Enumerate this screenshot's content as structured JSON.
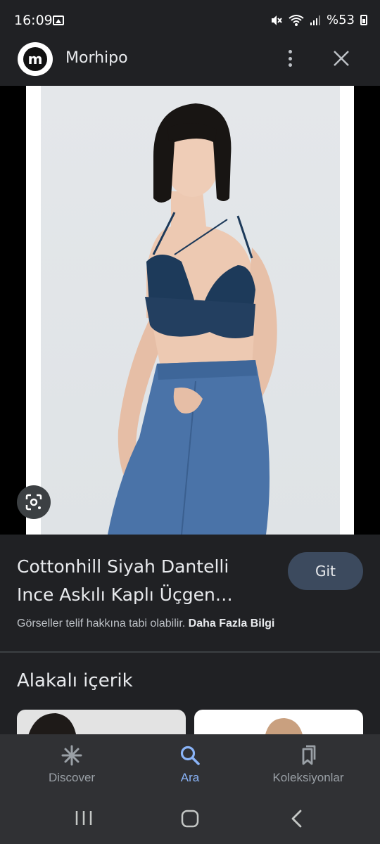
{
  "status_bar": {
    "time": "16:09",
    "battery": "%53"
  },
  "app_bar": {
    "logo_letter": "m",
    "title": "Morhipo"
  },
  "product": {
    "title_line1": "Cottonhill Siyah Dantelli",
    "title_line2": "Ince Askılı Kaplı Üçgen…",
    "visit_label": "Git",
    "copyright_text": "Görseller telif hakkına tabi olabilir. ",
    "copyright_link": "Daha Fazla Bilgi"
  },
  "related": {
    "title": "Alakalı içerik"
  },
  "bottom_nav": {
    "items": [
      {
        "label": "Discover",
        "icon": "asterisk-icon",
        "active": false
      },
      {
        "label": "Ara",
        "icon": "search-icon",
        "active": true
      },
      {
        "label": "Koleksiyonlar",
        "icon": "collections-icon",
        "active": false
      }
    ]
  },
  "colors": {
    "background": "#202124",
    "accent": "#8ab4f8",
    "button_bg": "#3c4a5e"
  }
}
